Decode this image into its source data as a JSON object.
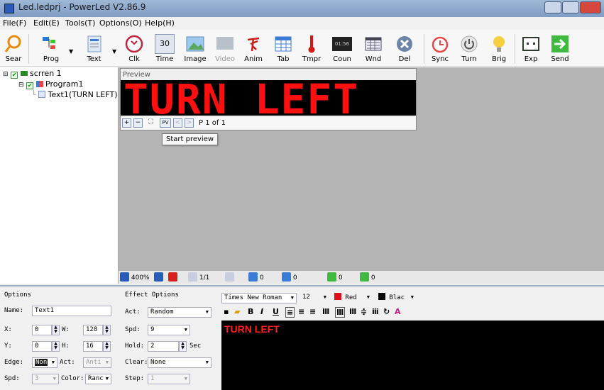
{
  "window": {
    "title": "Led.ledprj - PowerLed V2.86.9"
  },
  "menu": [
    "File(F)",
    "Edit(E)",
    "Tools(T)",
    "Options(O)",
    "Help(H)"
  ],
  "toolbar": {
    "items": [
      {
        "label": "Sear",
        "icon": "search-icon"
      },
      {
        "label": "Prog",
        "icon": "program-icon"
      },
      {
        "label": "Text",
        "icon": "text-icon"
      },
      {
        "label": "Clk",
        "icon": "clock-icon"
      },
      {
        "label": "Time",
        "icon": "calendar-icon",
        "badge": "30"
      },
      {
        "label": "Image",
        "icon": "image-icon"
      },
      {
        "label": "Video",
        "icon": "video-icon"
      },
      {
        "label": "Anim",
        "icon": "animation-icon"
      },
      {
        "label": "Tab",
        "icon": "table-icon"
      },
      {
        "label": "Tmpr",
        "icon": "thermometer-icon"
      },
      {
        "label": "Coun",
        "icon": "counter-icon",
        "badge": "01:56"
      },
      {
        "label": "Wnd",
        "icon": "window-icon"
      },
      {
        "label": "Del",
        "icon": "delete-icon"
      },
      {
        "label": "Sync",
        "icon": "alarm-clock-icon"
      },
      {
        "label": "Turn",
        "icon": "power-icon"
      },
      {
        "label": "Brig",
        "icon": "bulb-icon"
      },
      {
        "label": "Exp",
        "icon": "export-icon"
      },
      {
        "label": "Send",
        "icon": "send-arrow-icon"
      }
    ]
  },
  "tree": {
    "screen": "scrren 1",
    "program": "Program1",
    "text": "Text1(TURN LEFT)"
  },
  "preview": {
    "header": "Preview",
    "led_text": "TURN LEFT",
    "page_info": "P 1 of 1",
    "pv_label": "PV",
    "tooltip": "Start preview"
  },
  "zoombar": {
    "zoom": "400%",
    "frame": "1/1",
    "counters": [
      "0",
      "0",
      "0",
      "0"
    ]
  },
  "options": {
    "title": "Options",
    "name_label": "Name:",
    "name_value": "Text1",
    "x_label": "X:",
    "x_value": "0",
    "w_label": "W:",
    "w_value": "128",
    "y_label": "Y:",
    "y_value": "0",
    "h_label": "H:",
    "h_value": "16",
    "edge_label": "Edge:",
    "edge_value": "Non",
    "act_label": "Act:",
    "act_value": "Anti",
    "spd_label": "Spd:",
    "spd_value": "3",
    "color_label": "Color:",
    "color_value": "Ranc"
  },
  "effect": {
    "title": "Effect Options",
    "act_label": "Act:",
    "act_value": "Random",
    "spd_label": "Spd:",
    "spd_value": "9",
    "hold_label": "Hold:",
    "hold_value": "2",
    "hold_unit": "Sec",
    "clear_label": "Clear:",
    "clear_value": "None",
    "step_label": "Step:",
    "step_value": "1"
  },
  "format": {
    "font": "Times New Roman",
    "size": "12",
    "color1": "Red",
    "color2": "Blac",
    "bold": "B",
    "italic": "I",
    "underline": "U"
  },
  "editor": {
    "text": "TURN LEFT"
  },
  "colors": {
    "led_red": "#ff1010",
    "accent": "#2a5bb8"
  }
}
